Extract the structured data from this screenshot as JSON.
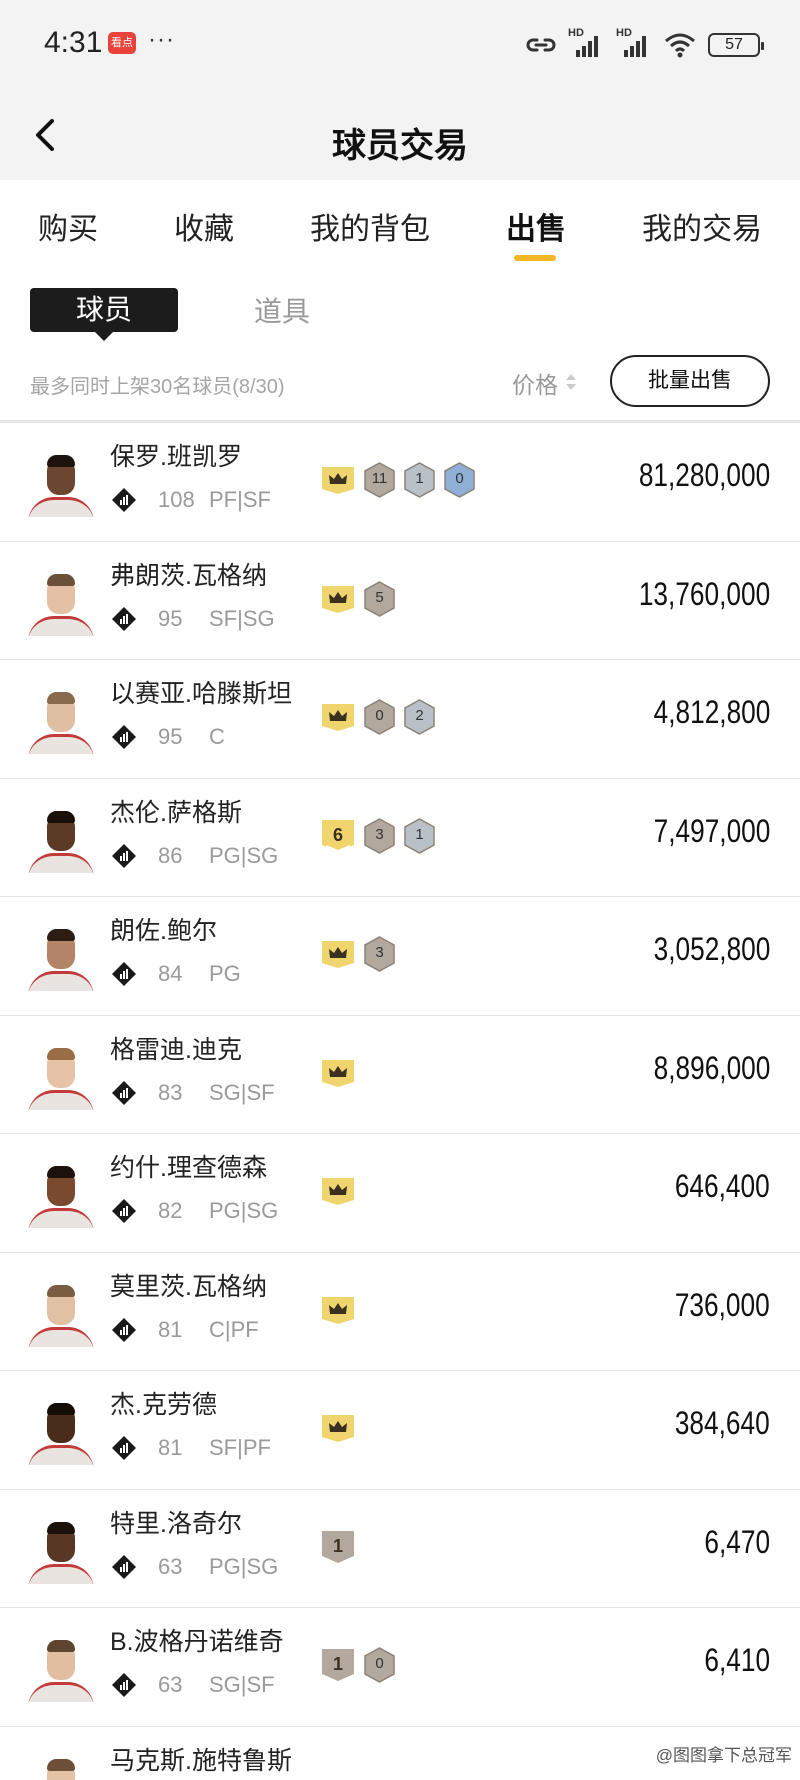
{
  "status": {
    "time": "4:31",
    "app_badge": "看点",
    "dots": "···",
    "battery": "57",
    "network_1": "HD",
    "network_2": "HD"
  },
  "header": {
    "title": "球员交易"
  },
  "tabs": [
    {
      "label": "购买",
      "active": false
    },
    {
      "label": "收藏",
      "active": false
    },
    {
      "label": "我的背包",
      "active": false
    },
    {
      "label": "出售",
      "active": true
    },
    {
      "label": "我的交易",
      "active": false
    }
  ],
  "subtabs": [
    {
      "label": "球员",
      "active": true
    },
    {
      "label": "道具",
      "active": false
    }
  ],
  "filter": {
    "limit_text": "最多同时上架30名球员(8/30)",
    "sort_label": "价格",
    "batch_button": "批量出售"
  },
  "colors": {
    "accent": "#f4b726",
    "crown_badge": "#f0d56e",
    "bronze_badge": "#b3a89e",
    "silver_badge": "#b9c0c8",
    "blue_badge": "#8eb0d6"
  },
  "players": [
    {
      "name": "保罗.班凯罗",
      "rating": "108",
      "position": "PF|SF",
      "price": "81,280,000",
      "skin": "#6b4630",
      "hair": "#1f140d",
      "badges": [
        {
          "type": "crown"
        },
        {
          "type": "num",
          "value": "11",
          "tone": "bronze"
        },
        {
          "type": "num",
          "value": "1",
          "tone": "silver"
        },
        {
          "type": "num",
          "value": "0",
          "tone": "blue"
        }
      ]
    },
    {
      "name": "弗朗茨.瓦格纳",
      "rating": "95",
      "position": "SF|SG",
      "price": "13,760,000",
      "skin": "#e4c1a4",
      "hair": "#6b5038",
      "badges": [
        {
          "type": "crown"
        },
        {
          "type": "num",
          "value": "5",
          "tone": "bronze"
        }
      ]
    },
    {
      "name": "以赛亚.哈滕斯坦",
      "rating": "95",
      "position": "C",
      "price": "4,812,800",
      "skin": "#e0bea2",
      "hair": "#8a6a4c",
      "badges": [
        {
          "type": "crown"
        },
        {
          "type": "num",
          "value": "0",
          "tone": "bronze"
        },
        {
          "type": "num",
          "value": "2",
          "tone": "silver"
        }
      ]
    },
    {
      "name": "杰伦.萨格斯",
      "rating": "86",
      "position": "PG|SG",
      "price": "7,497,000",
      "skin": "#5c3a26",
      "hair": "#1a100a",
      "badges": [
        {
          "type": "rank",
          "value": "6"
        },
        {
          "type": "num",
          "value": "3",
          "tone": "bronze"
        },
        {
          "type": "num",
          "value": "1",
          "tone": "silver"
        }
      ]
    },
    {
      "name": "朗佐.鲍尔",
      "rating": "84",
      "position": "PG",
      "price": "3,052,800",
      "skin": "#b48466",
      "hair": "#2b1d14",
      "badges": [
        {
          "type": "crown"
        },
        {
          "type": "num",
          "value": "3",
          "tone": "bronze"
        }
      ]
    },
    {
      "name": "格雷迪.迪克",
      "rating": "83",
      "position": "SG|SF",
      "price": "8,896,000",
      "skin": "#e6c3a6",
      "hair": "#9a6e44",
      "badges": [
        {
          "type": "crown"
        }
      ]
    },
    {
      "name": "约什.理查德森",
      "rating": "82",
      "position": "PG|SG",
      "price": "646,400",
      "skin": "#7a4a2e",
      "hair": "#1d120b",
      "badges": [
        {
          "type": "crown"
        }
      ]
    },
    {
      "name": "莫里茨.瓦格纳",
      "rating": "81",
      "position": "C|PF",
      "price": "736,000",
      "skin": "#e2c0a4",
      "hair": "#7a5c40",
      "badges": [
        {
          "type": "crown"
        }
      ]
    },
    {
      "name": "杰.克劳德",
      "rating": "81",
      "position": "SF|PF",
      "price": "384,640",
      "skin": "#4a2c1c",
      "hair": "#140c07",
      "badges": [
        {
          "type": "crown"
        }
      ]
    },
    {
      "name": "特里.洛奇尔",
      "rating": "63",
      "position": "PG|SG",
      "price": "6,470",
      "skin": "#5a3624",
      "hair": "#1a110a",
      "badges": [
        {
          "type": "rank",
          "value": "1"
        }
      ]
    },
    {
      "name": "B.波格丹诺维奇",
      "rating": "63",
      "position": "SG|SF",
      "price": "6,410",
      "skin": "#e1bea0",
      "hair": "#5e4530",
      "badges": [
        {
          "type": "rank",
          "value": "1"
        },
        {
          "type": "num",
          "value": "0",
          "tone": "bronze"
        }
      ]
    },
    {
      "name": "马克斯.施特鲁斯",
      "rating": "",
      "position": "",
      "price": "",
      "skin": "#e3c2a6",
      "hair": "#6e5038",
      "badges": []
    }
  ],
  "watermark": "@图图拿下总冠军"
}
